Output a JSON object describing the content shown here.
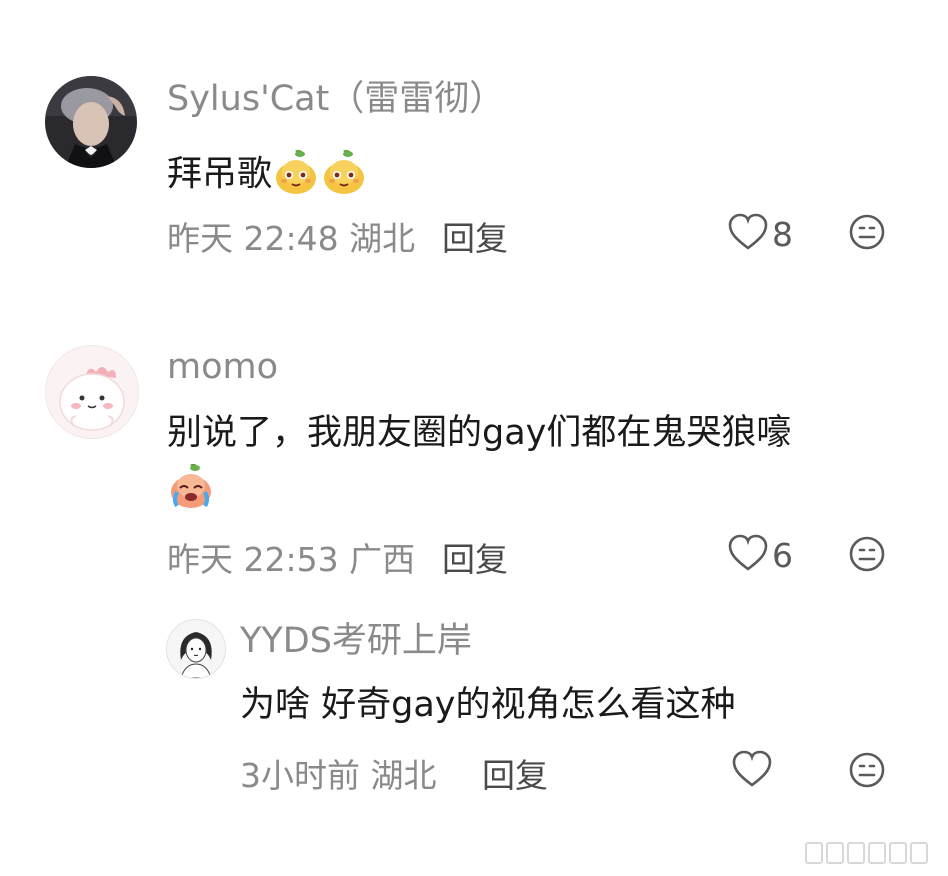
{
  "comments": [
    {
      "username": "Sylus'Cat（雷雷彻）",
      "text": "拜吊歌",
      "emoji": [
        "pear-smug-emoji",
        "pear-smug-emoji"
      ],
      "time": "昨天 22:48",
      "location": "湖北",
      "reply_label": "回复",
      "likes": "8"
    },
    {
      "username": "momo",
      "text_line1": "别说了，我朋友圈的gay们都在鬼哭狼嚎",
      "emoji": [
        "pear-crying-emoji"
      ],
      "time": "昨天 22:53",
      "location": "广西",
      "reply_label": "回复",
      "likes": "6",
      "replies": [
        {
          "username": "YYDS考研上岸",
          "text": "为啥 好奇gay的视角怎么看这种",
          "time": "3小时前",
          "location": "湖北",
          "reply_label": "回复",
          "likes": ""
        }
      ]
    }
  ],
  "icons": {
    "like": "heart-icon",
    "reaction": "neutral-face-icon"
  },
  "colors": {
    "secondary_text": "#8a8a8a",
    "primary_text": "#1a1a1a",
    "icon": "#5a5a5a"
  }
}
